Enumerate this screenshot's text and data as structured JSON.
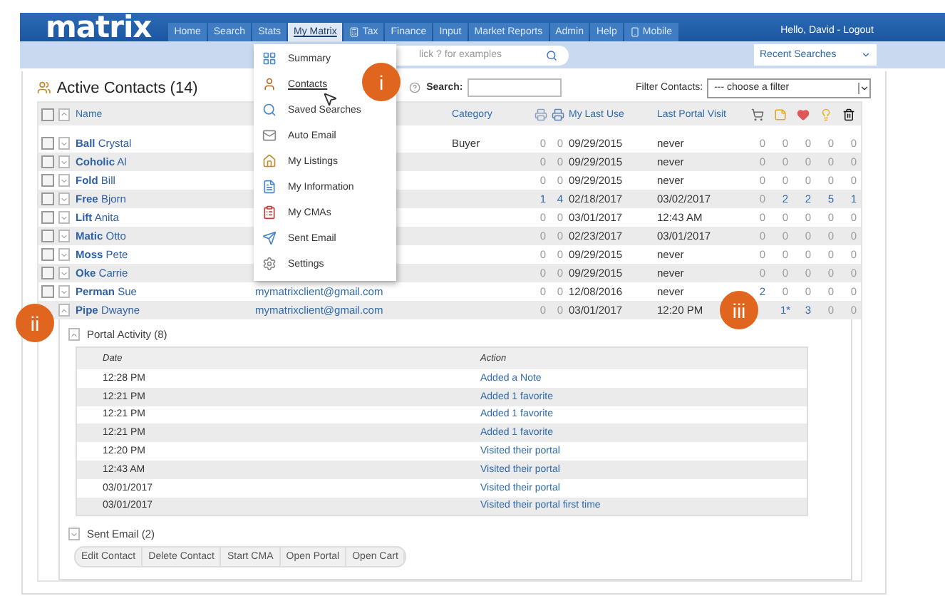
{
  "header": {
    "logo": "matrix",
    "greeting": "Hello, David - Logout",
    "nav": [
      {
        "label": "Home",
        "selected": false,
        "has_icon": false
      },
      {
        "label": "Search",
        "selected": false,
        "has_icon": false
      },
      {
        "label": "Stats",
        "selected": false,
        "has_icon": false
      },
      {
        "label": "My Matrix",
        "selected": true,
        "has_icon": false
      },
      {
        "label": "Tax",
        "selected": false,
        "has_icon": true
      },
      {
        "label": "Finance",
        "selected": false,
        "has_icon": false
      },
      {
        "label": "Input",
        "selected": false,
        "has_icon": false
      },
      {
        "label": "Market Reports",
        "selected": false,
        "has_icon": false
      },
      {
        "label": "Admin",
        "selected": false,
        "has_icon": false
      },
      {
        "label": "Help",
        "selected": false,
        "has_icon": false
      },
      {
        "label": "Mobile",
        "selected": false,
        "has_icon": true
      }
    ]
  },
  "search_bar": {
    "placeholder": "lick ? for examples",
    "recent_searches": "Recent Searches"
  },
  "menu": {
    "items": [
      {
        "label": "Summary",
        "selected": false,
        "kind": "summary"
      },
      {
        "label": "Contacts",
        "selected": true,
        "kind": "contacts"
      },
      {
        "label": "Saved Searches",
        "selected": false,
        "kind": "searches"
      },
      {
        "label": "Auto Email",
        "selected": false,
        "kind": "email"
      },
      {
        "label": "My Listings",
        "selected": false,
        "kind": "listings"
      },
      {
        "label": "My Information",
        "selected": false,
        "kind": "info"
      },
      {
        "label": "My CMAs",
        "selected": false,
        "kind": "cma"
      },
      {
        "label": "Sent Email",
        "selected": false,
        "kind": "sent"
      },
      {
        "label": "Settings",
        "selected": false,
        "kind": "settings"
      }
    ]
  },
  "callouts": [
    "i",
    "ii",
    "iii"
  ],
  "contacts": {
    "title": "Active Contacts (14)",
    "search_label": "Search:",
    "filter_label": "Filter Contacts:",
    "filter_placeholder": "--- choose a filter",
    "select_all_checked": false,
    "columns": {
      "name": "Name",
      "category": "Category",
      "my_last_use": "My Last Use",
      "last_portal_visit": "Last Portal Visit"
    },
    "rows": [
      {
        "last": "Ball",
        "first": "Crystal",
        "category": "Buyer",
        "checked": false,
        "expanded": false,
        "stats": [
          {
            "value": "0",
            "link": false
          },
          {
            "value": "0",
            "link": false
          }
        ],
        "last_use": "09/29/2015",
        "portal_visit": "never",
        "icons": [
          {
            "value": "0",
            "link": false
          },
          {
            "value": "0",
            "link": false
          },
          {
            "value": "0",
            "link": false
          },
          {
            "value": "0",
            "link": false
          },
          {
            "value": "0",
            "link": false
          }
        ]
      },
      {
        "last": "Coholic",
        "first": "Al",
        "checked": false,
        "expanded": false,
        "stats": [
          {
            "value": "0",
            "link": false
          },
          {
            "value": "0",
            "link": false
          }
        ],
        "last_use": "09/29/2015",
        "portal_visit": "never",
        "icons": [
          {
            "value": "0",
            "link": false
          },
          {
            "value": "0",
            "link": false
          },
          {
            "value": "0",
            "link": false
          },
          {
            "value": "0",
            "link": false
          },
          {
            "value": "0",
            "link": false
          }
        ]
      },
      {
        "last": "Fold",
        "first": "Bill",
        "checked": false,
        "expanded": false,
        "stats": [
          {
            "value": "0",
            "link": false
          },
          {
            "value": "0",
            "link": false
          }
        ],
        "last_use": "09/29/2015",
        "portal_visit": "never",
        "icons": [
          {
            "value": "0",
            "link": false
          },
          {
            "value": "0",
            "link": false
          },
          {
            "value": "0",
            "link": false
          },
          {
            "value": "0",
            "link": false
          },
          {
            "value": "0",
            "link": false
          }
        ]
      },
      {
        "last": "Free",
        "first": "Bjorn",
        "checked": false,
        "expanded": false,
        "stats": [
          {
            "value": "1",
            "link": true
          },
          {
            "value": "4",
            "link": true
          }
        ],
        "last_use": "02/18/2017",
        "portal_visit": "03/02/2017",
        "icons": [
          {
            "value": "0",
            "link": false
          },
          {
            "value": "2",
            "link": true
          },
          {
            "value": "2",
            "link": true
          },
          {
            "value": "5",
            "link": true
          },
          {
            "value": "1",
            "link": true
          }
        ]
      },
      {
        "last": "Lift",
        "first": "Anita",
        "checked": false,
        "expanded": false,
        "stats": [
          {
            "value": "0",
            "link": false
          },
          {
            "value": "0",
            "link": false
          }
        ],
        "last_use": "03/01/2017",
        "portal_visit": "12:43 AM",
        "icons": [
          {
            "value": "0",
            "link": false
          },
          {
            "value": "0",
            "link": false
          },
          {
            "value": "0",
            "link": false
          },
          {
            "value": "0",
            "link": false
          },
          {
            "value": "0",
            "link": false
          }
        ]
      },
      {
        "last": "Matic",
        "first": "Otto",
        "checked": false,
        "expanded": false,
        "stats": [
          {
            "value": "0",
            "link": false
          },
          {
            "value": "0",
            "link": false
          }
        ],
        "last_use": "02/23/2017",
        "portal_visit": "03/01/2017",
        "icons": [
          {
            "value": "0",
            "link": false
          },
          {
            "value": "0",
            "link": false
          },
          {
            "value": "0",
            "link": false
          },
          {
            "value": "0",
            "link": false
          },
          {
            "value": "0",
            "link": false
          }
        ]
      },
      {
        "last": "Moss",
        "first": "Pete",
        "checked": false,
        "expanded": false,
        "stats": [
          {
            "value": "0",
            "link": false
          },
          {
            "value": "0",
            "link": false
          }
        ],
        "last_use": "09/29/2015",
        "portal_visit": "never",
        "icons": [
          {
            "value": "0",
            "link": false
          },
          {
            "value": "0",
            "link": false
          },
          {
            "value": "0",
            "link": false
          },
          {
            "value": "0",
            "link": false
          },
          {
            "value": "0",
            "link": false
          }
        ]
      },
      {
        "last": "Oke",
        "first": "Carrie",
        "checked": false,
        "expanded": false,
        "stats": [
          {
            "value": "0",
            "link": false
          },
          {
            "value": "0",
            "link": false
          }
        ],
        "last_use": "09/29/2015",
        "portal_visit": "never",
        "icons": [
          {
            "value": "0",
            "link": false
          },
          {
            "value": "0",
            "link": false
          },
          {
            "value": "0",
            "link": false
          },
          {
            "value": "0",
            "link": false
          },
          {
            "value": "0",
            "link": false
          }
        ]
      },
      {
        "last": "Perman",
        "first": "Sue",
        "email": "mymatrixclient@gmail.com",
        "checked": false,
        "expanded": false,
        "stats": [
          {
            "value": "0",
            "link": false
          },
          {
            "value": "0",
            "link": false
          }
        ],
        "last_use": "12/08/2016",
        "portal_visit": "never",
        "icons": [
          {
            "value": "2",
            "link": true
          },
          {
            "value": "0",
            "link": false
          },
          {
            "value": "0",
            "link": false
          },
          {
            "value": "0",
            "link": false
          },
          {
            "value": "0",
            "link": false
          }
        ]
      },
      {
        "last": "Pipe",
        "first": "Dwayne",
        "email": "mymatrixclient@gmail.com",
        "expanded": true,
        "stats": [
          {
            "value": "0",
            "link": false
          },
          {
            "value": "0",
            "link": false
          }
        ],
        "last_use": "03/01/2017",
        "portal_visit": "12:20 PM",
        "icons": [
          {
            "value": "1*",
            "link": true
          },
          {
            "value": "3",
            "link": true
          },
          {
            "value": "0",
            "link": false
          },
          {
            "value": "0",
            "link": false
          }
        ],
        "details": {
          "sections": [
            {
              "title": "Portal Activity (8)",
              "expanded": true,
              "columns": [
                "Date",
                "Action"
              ],
              "rows": [
                {
                  "date": "12:28 PM",
                  "action": "Added a Note"
                },
                {
                  "date": "12:21 PM",
                  "action": "Added 1 favorite"
                },
                {
                  "date": "12:21 PM",
                  "action": "Added 1 favorite"
                },
                {
                  "date": "12:21 PM",
                  "action": "Added 1 favorite"
                },
                {
                  "date": "12:20 PM",
                  "action": "Visited their portal"
                },
                {
                  "date": "12:43 AM",
                  "action": "Visited their portal"
                },
                {
                  "date": "03/01/2017",
                  "action": "Visited their portal"
                },
                {
                  "date": "03/01/2017",
                  "action": "Visited their portal first time"
                }
              ]
            },
            {
              "title": "Sent Email (2)",
              "expanded": false
            }
          ],
          "buttons": [
            "Edit Contact",
            "Delete Contact",
            "Start CMA",
            "Open Portal",
            "Open Cart"
          ]
        }
      }
    ]
  }
}
